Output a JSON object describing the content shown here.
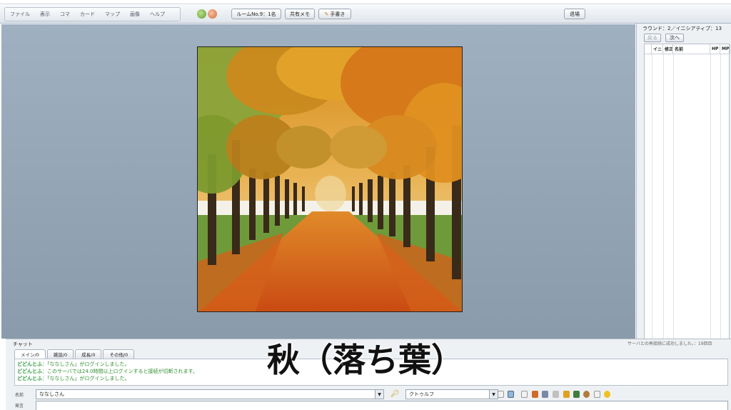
{
  "menubar": {
    "items": [
      "ファイル",
      "表示",
      "コマ",
      "カード",
      "マップ",
      "画像",
      "ヘルプ"
    ],
    "room_button": "ルームNo.9：1名",
    "shared_memo_button": "共有メモ",
    "draw_button": "手書き",
    "exit_button": "退場"
  },
  "initiative": {
    "title": "ラウンド：2／イニシアティブ：13",
    "back_button": "戻る",
    "next_button": "次へ",
    "columns": [
      "",
      "イニ",
      "修正",
      "名前",
      "HP",
      "MP"
    ]
  },
  "chat": {
    "title": "チャット",
    "server_status": "サーバとの再接続に成功しました。：19回目",
    "tabs": [
      "メイン/0",
      "雑談/0",
      "成長/0",
      "その他/0"
    ],
    "messages": [
      {
        "sender": "どどんとふ",
        "text": "：「ななしさん」がログインしました。"
      },
      {
        "sender": "どどんとふ",
        "text": "：このサーバでは24.0時間以上ログインすると接続が切断されます。"
      },
      {
        "sender": "どどんとふ",
        "text": "：「ななしさん」がログインしました。"
      }
    ],
    "name_label": "名前",
    "name_value": "ななしさん",
    "system_value": "クトゥルフ",
    "message_label": "発言"
  },
  "caption": "秋（落ち葉）",
  "colors": {
    "stage_bg": "#93a4b5",
    "log_text": "#2f8f2f",
    "caption": "#111111"
  },
  "icons": [
    "key-icon",
    "dice-icon",
    "sound-icon",
    "color-icon"
  ]
}
